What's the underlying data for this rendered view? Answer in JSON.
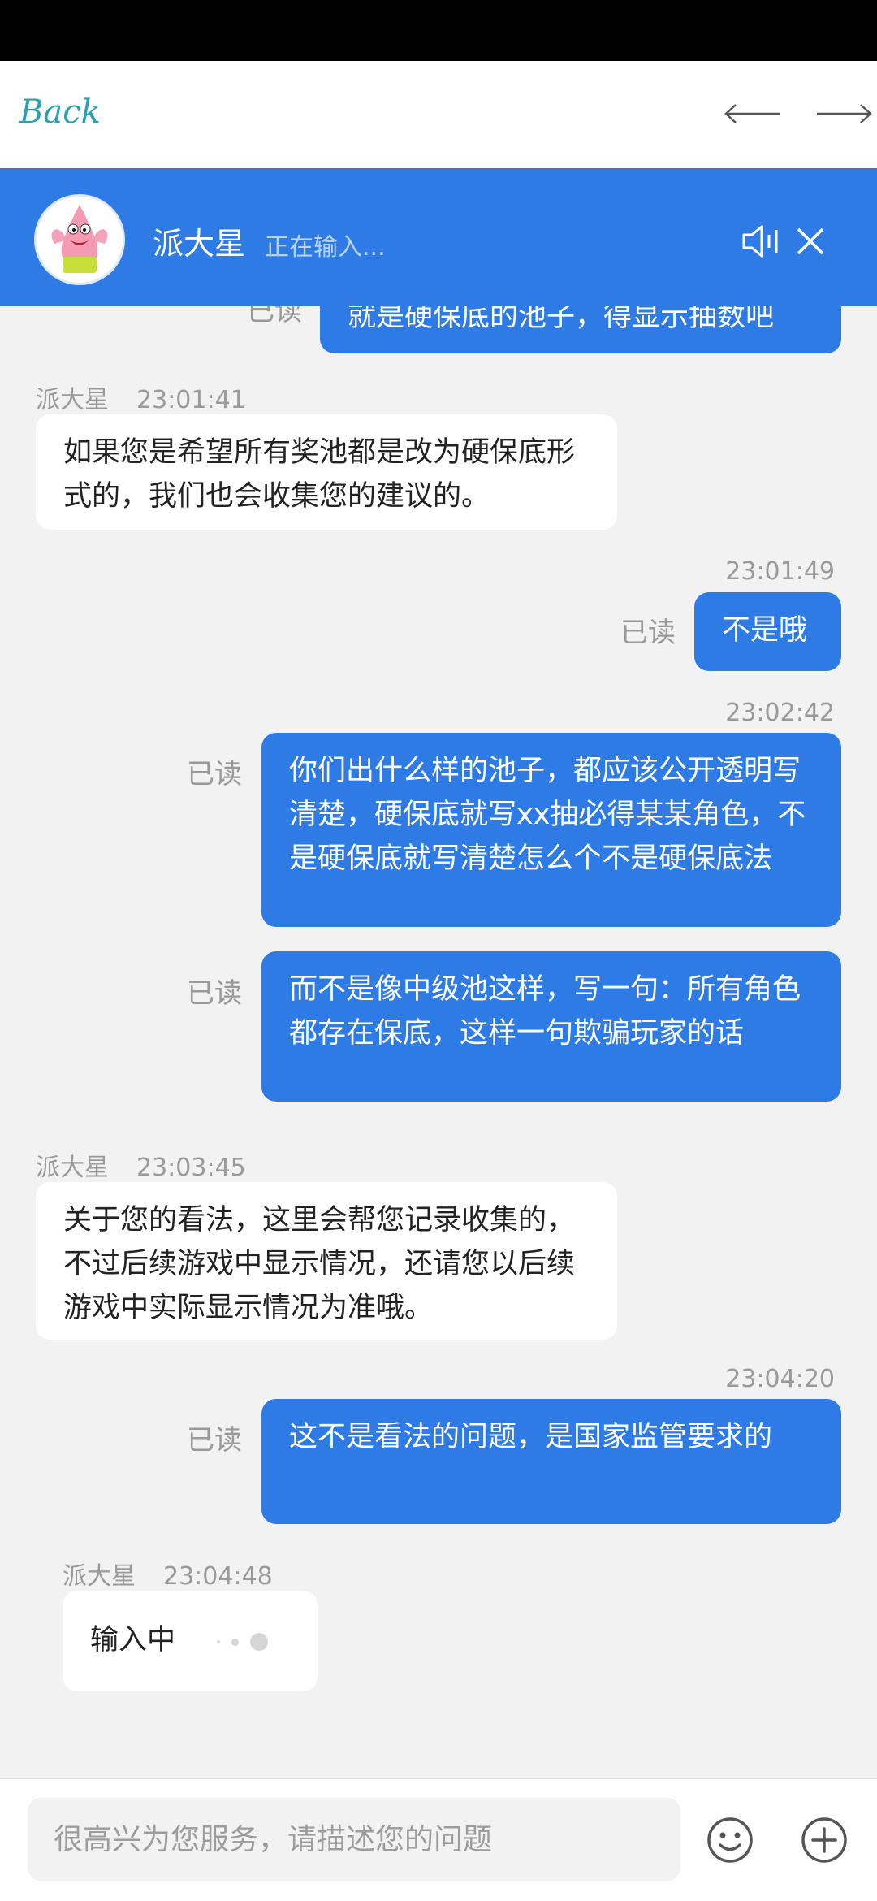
{
  "nav": {
    "back_label": "Back"
  },
  "header": {
    "agent_name": "派大星",
    "status": "正在输入..."
  },
  "messages": {
    "m0": {
      "read": "已读",
      "text": "就是硬保底的池子，得显示抽数吧"
    },
    "m1": {
      "name": "派大星",
      "time": "23:01:41",
      "text": "如果您是希望所有奖池都是改为硬保底形式的，我们也会收集您的建议的。"
    },
    "m2": {
      "time": "23:01:49",
      "read": "已读",
      "text": "不是哦"
    },
    "m3": {
      "time": "23:02:42",
      "read": "已读",
      "text": "你们出什么样的池子，都应该公开透明写清楚，硬保底就写xx抽必得某某角色，不是硬保底就写清楚怎么个不是硬保底法"
    },
    "m4": {
      "read": "已读",
      "text": "而不是像中级池这样，写一句：所有角色都存在保底，这样一句欺骗玩家的话"
    },
    "m5": {
      "name": "派大星",
      "time": "23:03:45",
      "text": "关于您的看法，这里会帮您记录收集的，不过后续游戏中显示情况，还请您以后续游戏中实际显示情况为准哦。"
    },
    "m6": {
      "time": "23:04:20",
      "read": "已读",
      "text": "这不是看法的问题，是国家监管要求的"
    },
    "m7": {
      "name": "派大星",
      "time": "23:04:48",
      "text": "输入中"
    }
  },
  "input": {
    "placeholder": "很高兴为您服务，请描述您的问题"
  },
  "colors": {
    "accent": "#2f7be6",
    "background": "#f2f2f2",
    "back_link": "#2aa0b0"
  },
  "icons": [
    "arrow-left-icon",
    "arrow-right-icon",
    "speaker-icon",
    "close-icon",
    "emoji-icon",
    "plus-icon"
  ]
}
